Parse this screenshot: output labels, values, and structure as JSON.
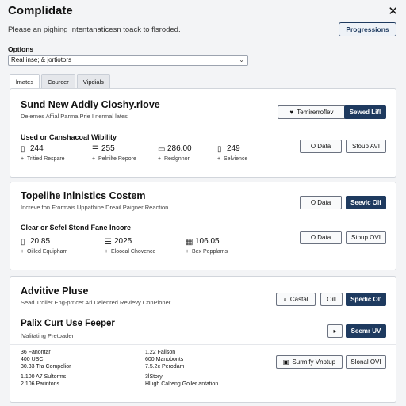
{
  "header": {
    "title": "Complidate",
    "subtitle": "Please an pighing Intentanaticesn toack to flsroded.",
    "progress_button": "Progressions",
    "close_glyph": "✕"
  },
  "options": {
    "label": "Options",
    "selected": "Real inse; & jortiotors"
  },
  "tabs": [
    "lmates",
    "Courcer",
    "Vipdials"
  ],
  "panel1": {
    "title": "Sund New Addly Closhy.rlove",
    "description": "Delernes Affial Parma Prie I nermal lates",
    "button_secondary": "Temirerroflev",
    "button_primary": "Sewed Lifl",
    "section_title": "Used or Canshacoal Wibility",
    "stats": [
      {
        "value": "244",
        "label": "Tritied Respare",
        "icon": "document-icon"
      },
      {
        "value": "255",
        "label": "Pelnilte Repore",
        "icon": "list-icon"
      },
      {
        "value": "286.00",
        "label": "Reslgnnor",
        "icon": "monitor-icon"
      },
      {
        "value": "249",
        "label": "Selvience",
        "icon": "document-icon"
      }
    ],
    "button_data": "O Data",
    "button_stoup": "Stoup AVI"
  },
  "panel2": {
    "title": "Topelihe Inlnistics Costem",
    "description": "Increve fon Frormais Uppathine Dreail Paigner Reaction",
    "button_data": "O Data",
    "button_primary": "Seevic Oif",
    "section_title": "Clear or Sefel Stond Fane Incore",
    "stats": [
      {
        "value": "20.85",
        "label": "Oilled Equipham",
        "icon": "document-icon"
      },
      {
        "value": "2025",
        "label": "Eloocal Chovence",
        "icon": "list-icon"
      },
      {
        "value": "106.05",
        "label": "Bex Pepplams",
        "icon": "grid-icon"
      }
    ],
    "button_data2": "O Data",
    "button_stoup": "Stoup OVI"
  },
  "panel3": {
    "title": "Advitive Pluse",
    "description": "Sead Troller Eng-prricer Arl Delenred Revievy ConPloner",
    "button_castal": "Castal",
    "button_oil": "Oill",
    "button_primary": "Spedic Ol'",
    "section_title": "Palix Curt Use Feeper",
    "section_desc": "lValitating Pretoader",
    "button_seemr": "Seemr UV",
    "button_surmify": "Surmify Vnptup",
    "button_slonal": "Slonal OVI",
    "list_left": [
      "36 Fanontar",
      "400 USC",
      "30.33 Tra Compolior"
    ],
    "list_right": [
      "1.22 Fallson",
      "600 Manobonts",
      "7.5.2c Perodam"
    ],
    "list_left2": [
      "1.100 A7 Sultorms",
      "2.106 Parintons"
    ],
    "list_right2": [
      "3lStory",
      "Hlugh Calreng Goller antation"
    ]
  }
}
